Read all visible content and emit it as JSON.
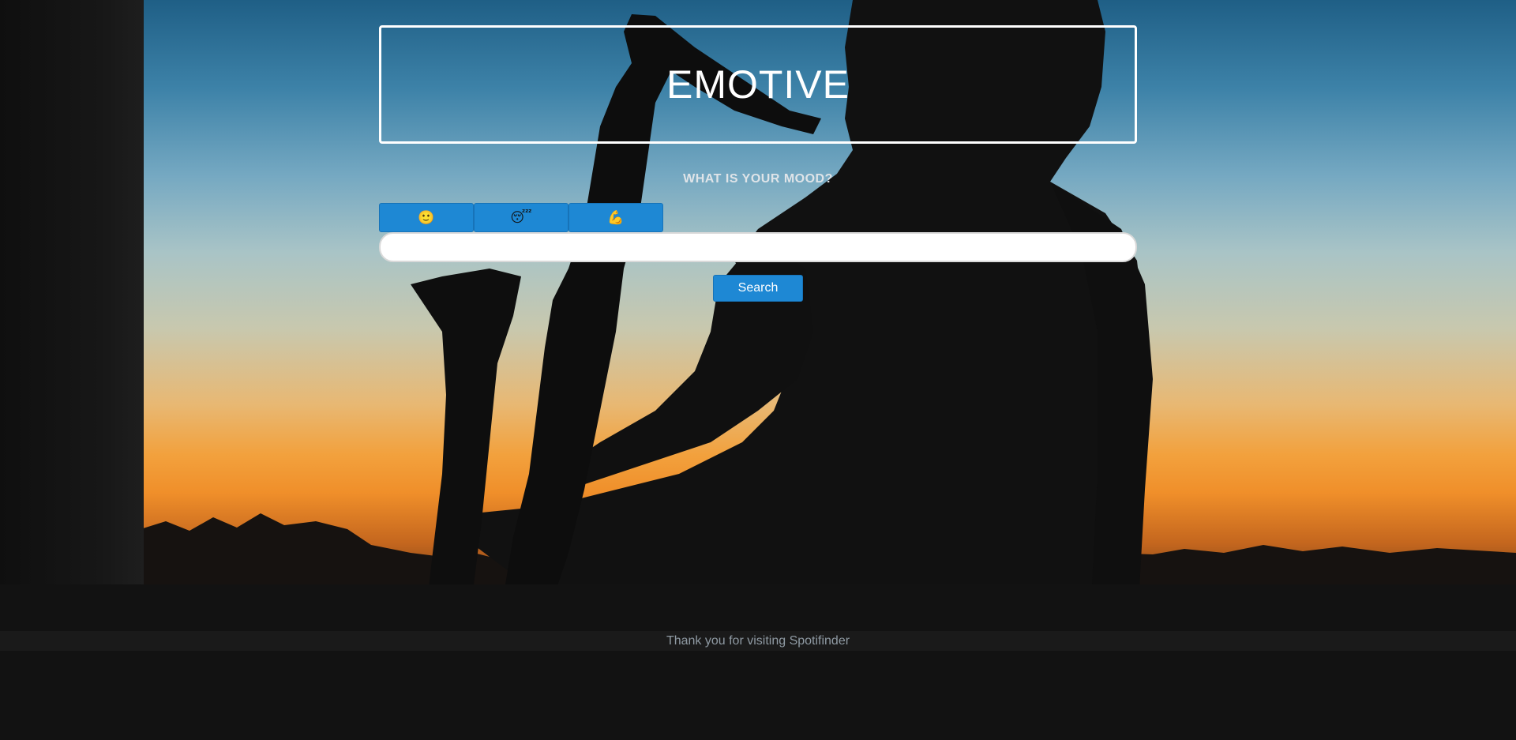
{
  "header": {
    "title": "EMOTIVE"
  },
  "mood": {
    "question": "WHAT IS YOUR MOOD?",
    "buttons": [
      {
        "icon": "slightly-smiling-face-icon",
        "glyph": "🙂"
      },
      {
        "icon": "sleeping-face-icon",
        "glyph": "😴"
      },
      {
        "icon": "flexed-biceps-icon",
        "glyph": "💪"
      }
    ]
  },
  "search": {
    "value": "",
    "placeholder": "",
    "button_label": "Search"
  },
  "footer": {
    "text": "Thank you for visiting Spotifinder"
  },
  "colors": {
    "accent": "#1e88d4",
    "title_border": "#ffffff",
    "footer_bg": "#1a1a1a",
    "footer_text": "#8f9aa3"
  }
}
